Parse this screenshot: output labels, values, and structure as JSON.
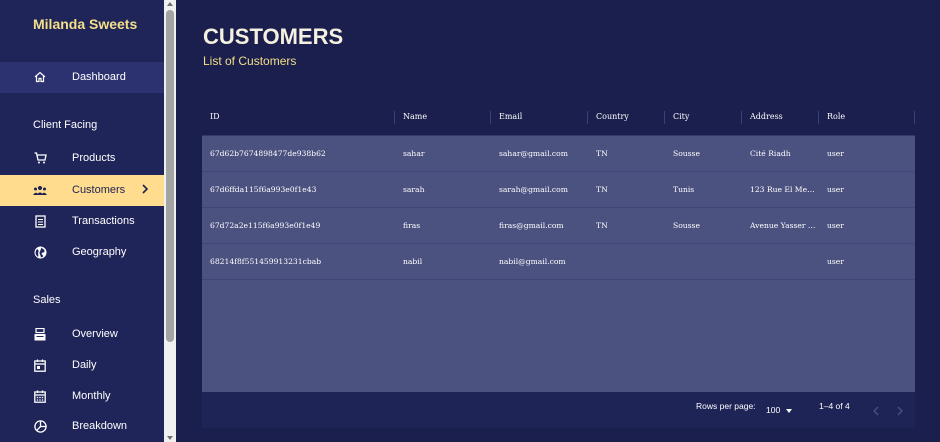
{
  "sidebar": {
    "brand": "Milanda Sweets",
    "dashboard": "Dashboard",
    "section_client": "Client Facing",
    "products": "Products",
    "customers": "Customers",
    "transactions": "Transactions",
    "geography": "Geography",
    "section_sales": "Sales",
    "overview": "Overview",
    "daily": "Daily",
    "monthly": "Monthly",
    "breakdown": "Breakdown"
  },
  "page": {
    "title": "CUSTOMERS",
    "subtitle": "List of Customers"
  },
  "table": {
    "columns": [
      "ID",
      "Name",
      "Email",
      "Country",
      "City",
      "Address",
      "Role"
    ],
    "rows": [
      [
        "67d62b7674898477de938b62",
        "sahar",
        "sahar@gmail.com",
        "TN",
        "Sousse",
        "Cité Riadh",
        "user"
      ],
      [
        "67d6ffda115f6a993e0f1e43",
        "sarah",
        "sarah@gmail.com",
        "TN",
        "Tunis",
        "123 Rue El Me…",
        "user"
      ],
      [
        "67d72a2e115f6a993e0f1e49",
        "firas",
        "firas@gmail.com",
        "TN",
        "Sousse",
        "Avenue Yasser …",
        "user"
      ],
      [
        "68214f8f551459913231cbab",
        "nabil",
        "nabil@gmail.com",
        "",
        "",
        "",
        "user"
      ]
    ],
    "rows_per_page_label": "Rows per page:",
    "rows_per_page": "100",
    "page_info": "1–4 of 4"
  },
  "colors": {
    "background": "#1b1f4d",
    "sidebar": "#202559",
    "accent": "#ffdc8e",
    "table_body": "#4c5280"
  }
}
